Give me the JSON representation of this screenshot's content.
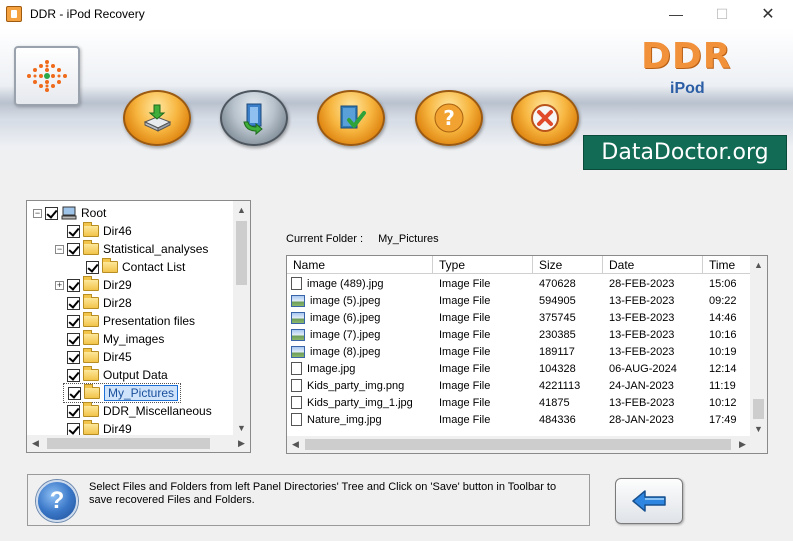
{
  "window": {
    "title": "DDR - iPod Recovery",
    "minimize": "—",
    "maximize": "☐",
    "close": "✕"
  },
  "branding": {
    "ddr": "DDR",
    "product": "iPod",
    "site": "DataDoctor.org",
    "ddr_color": "#f1913a",
    "banner_color": "#126b55"
  },
  "toolbar": [
    {
      "name": "save-button",
      "icon": "save-drive-icon"
    },
    {
      "name": "load-button",
      "icon": "load-data-icon"
    },
    {
      "name": "open-button",
      "icon": "book-check-icon"
    },
    {
      "name": "help-button",
      "icon": "question-icon"
    },
    {
      "name": "exit-button",
      "icon": "close-x-icon"
    }
  ],
  "tree": {
    "root": "Root",
    "items": [
      {
        "label": "Dir46"
      },
      {
        "label": "Statistical_analyses"
      },
      {
        "label": "Contact List"
      },
      {
        "label": "Dir29"
      },
      {
        "label": "Dir28"
      },
      {
        "label": "Presentation files"
      },
      {
        "label": "My_images"
      },
      {
        "label": "Dir45"
      },
      {
        "label": "Output Data"
      },
      {
        "label": "My_Pictures",
        "selected": true
      },
      {
        "label": "DDR_Miscellaneous"
      },
      {
        "label": "Dir49"
      }
    ]
  },
  "current_folder": {
    "label": "Current Folder :",
    "value": "My_Pictures"
  },
  "file_list": {
    "columns": [
      "Name",
      "Type",
      "Size",
      "Date",
      "Time"
    ],
    "rows": [
      {
        "name": "image (489).jpg",
        "type": "Image File",
        "size": "470628",
        "date": "28-FEB-2023",
        "time": "15:06",
        "icon": "file-icon"
      },
      {
        "name": "image (5).jpeg",
        "type": "Image File",
        "size": "594905",
        "date": "13-FEB-2023",
        "time": "09:22",
        "icon": "image-file-icon"
      },
      {
        "name": "image (6).jpeg",
        "type": "Image File",
        "size": "375745",
        "date": "13-FEB-2023",
        "time": "14:46",
        "icon": "image-file-icon"
      },
      {
        "name": "image (7).jpeg",
        "type": "Image File",
        "size": "230385",
        "date": "13-FEB-2023",
        "time": "10:16",
        "icon": "image-file-icon"
      },
      {
        "name": "image (8).jpeg",
        "type": "Image File",
        "size": "189117",
        "date": "13-FEB-2023",
        "time": "10:19",
        "icon": "image-file-icon"
      },
      {
        "name": "Image.jpg",
        "type": "Image File",
        "size": "104328",
        "date": "06-AUG-2024",
        "time": "12:14",
        "icon": "file-icon"
      },
      {
        "name": "Kids_party_img.png",
        "type": "Image File",
        "size": "4221113",
        "date": "24-JAN-2023",
        "time": "11:19",
        "icon": "file-icon"
      },
      {
        "name": "Kids_party_img_1.jpg",
        "type": "Image File",
        "size": "41875",
        "date": "13-FEB-2023",
        "time": "10:12",
        "icon": "file-icon"
      },
      {
        "name": "Nature_img.jpg",
        "type": "Image File",
        "size": "484336",
        "date": "28-JAN-2023",
        "time": "17:49",
        "icon": "file-icon"
      }
    ]
  },
  "help": {
    "text": "Select Files and Folders from left Panel Directories' Tree and Click on 'Save' button in Toolbar to save recovered Files and Folders.",
    "icon_glyph": "?"
  },
  "back_button": {
    "icon": "back-arrow-icon"
  }
}
